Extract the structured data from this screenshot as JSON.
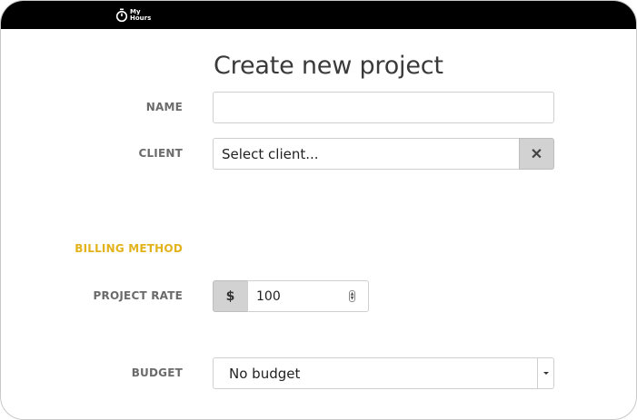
{
  "app": {
    "logo_line1": "My",
    "logo_line2": "Hours",
    "logo_icon": "stopwatch-icon"
  },
  "form": {
    "title": "Create new project",
    "name": {
      "label": "NAME",
      "value": "",
      "placeholder": ""
    },
    "client": {
      "label": "CLIENT",
      "value": "Select client...",
      "clear_icon": "close-icon",
      "clear_glyph": "✕"
    },
    "billing_method": {
      "label": "BILLING METHOD"
    },
    "project_rate": {
      "label": "PROJECT RATE",
      "currency": "$",
      "value": "100"
    },
    "budget": {
      "label": "BUDGET",
      "value": "No budget",
      "caret_icon": "caret-down-icon"
    }
  },
  "colors": {
    "topbar": "#000000",
    "accent_label": "#e2b31c",
    "label": "#6b6b6b",
    "addon_bg": "#d2d2d2"
  }
}
